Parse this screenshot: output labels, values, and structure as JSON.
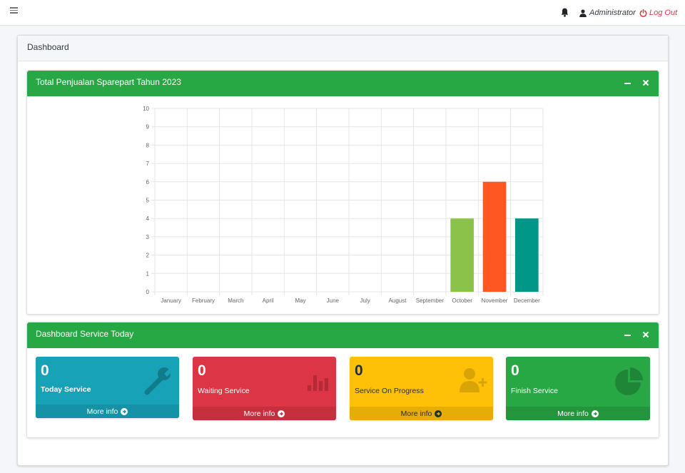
{
  "topbar": {
    "user": "Administrator",
    "logout": "Log Out"
  },
  "page": {
    "title": "Dashboard"
  },
  "sales_panel": {
    "title": "Total Penjualan Sparepart Tahun 2023"
  },
  "service_panel": {
    "title": "Dashboard Service Today"
  },
  "chart_data": {
    "type": "bar",
    "categories": [
      "January",
      "February",
      "March",
      "April",
      "May",
      "June",
      "July",
      "August",
      "September",
      "October",
      "November",
      "December"
    ],
    "values": [
      0,
      0,
      0,
      0,
      0,
      0,
      0,
      0,
      0,
      4,
      6,
      4
    ],
    "colors": [
      "#8bc34a",
      "#ff5722",
      "#009688"
    ],
    "ylim": [
      0,
      10
    ],
    "yticks": [
      0,
      1,
      2,
      3,
      4,
      5,
      6,
      7,
      8,
      9,
      10
    ],
    "grid": true,
    "title": "",
    "xlabel": "",
    "ylabel": ""
  },
  "boxes": [
    {
      "count": "0",
      "label": "Today Service",
      "more": "More info",
      "color": "#17a2b8",
      "icon": "wrench-icon"
    },
    {
      "count": "0",
      "label": "Waiting Service",
      "more": "More info",
      "color": "#dc3545",
      "icon": "bar-chart-icon"
    },
    {
      "count": "0",
      "label": "Service On Progress",
      "more": "More info",
      "color": "#ffc107",
      "icon": "user-plus-icon"
    },
    {
      "count": "0",
      "label": "Finish Service",
      "more": "More info",
      "color": "#28a745",
      "icon": "pie-chart-icon"
    }
  ]
}
